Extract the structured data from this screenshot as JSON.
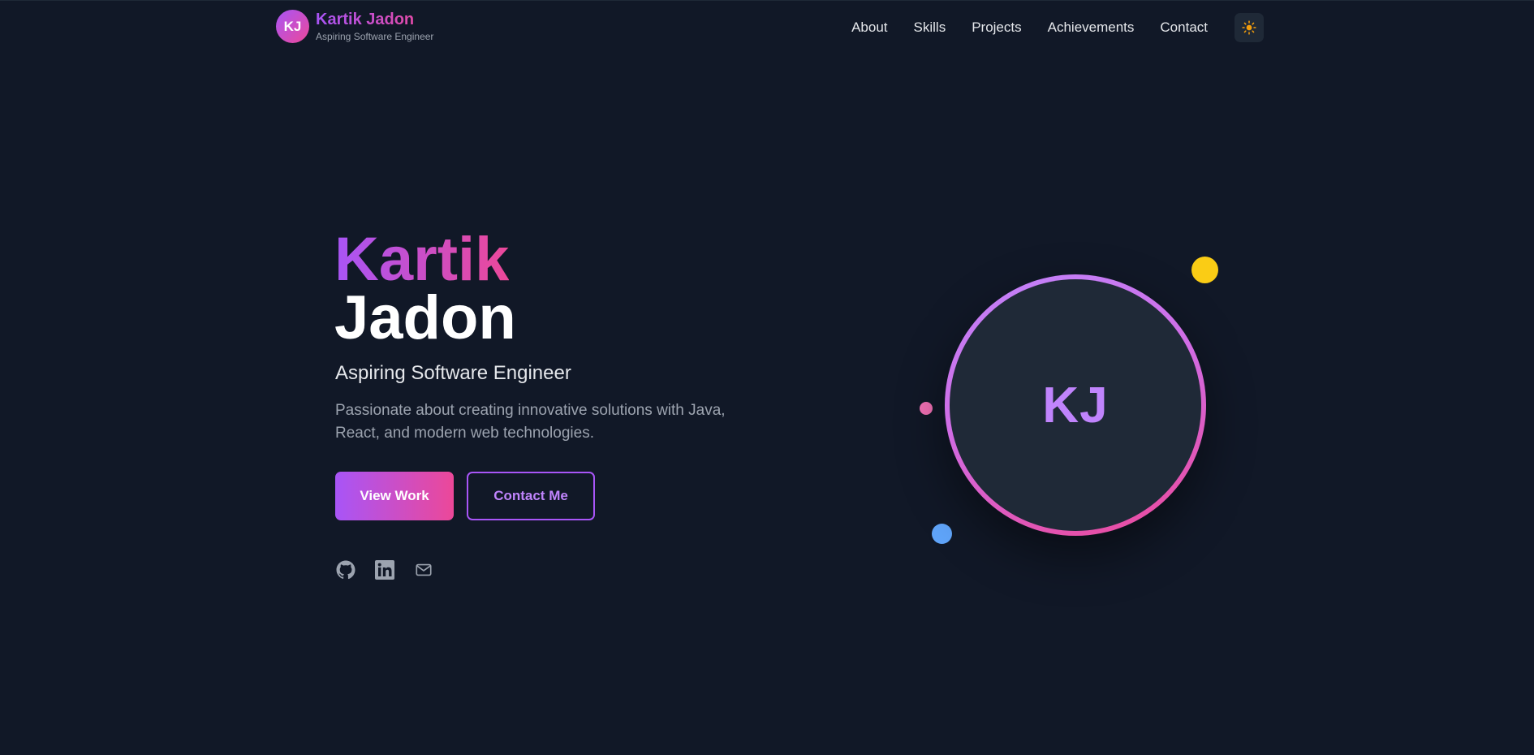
{
  "header": {
    "brand": {
      "initials": "KJ",
      "name": "Kartik Jadon",
      "tagline": "Aspiring Software Engineer"
    },
    "nav": [
      {
        "label": "About"
      },
      {
        "label": "Skills"
      },
      {
        "label": "Projects"
      },
      {
        "label": "Achievements"
      },
      {
        "label": "Contact"
      }
    ],
    "theme_toggle_icon": "sun-icon"
  },
  "hero": {
    "first_name": "Kartik",
    "last_name": "Jadon",
    "role": "Aspiring Software Engineer",
    "description": "Passionate about creating innovative solutions with Java, React, and modern web technologies.",
    "primary_button": "View Work",
    "secondary_button": "Contact Me",
    "social_icons": [
      "github-icon",
      "linkedin-icon",
      "mail-icon"
    ],
    "avatar_initials": "KJ"
  },
  "colors": {
    "background": "#111827",
    "surface": "#1f2937",
    "accent_purple": "#a855f7",
    "accent_pink": "#ec4899",
    "dot_yellow": "#facc15",
    "dot_pink": "#f472b6",
    "dot_blue": "#60a5fa",
    "muted_text": "#9ca3af"
  }
}
